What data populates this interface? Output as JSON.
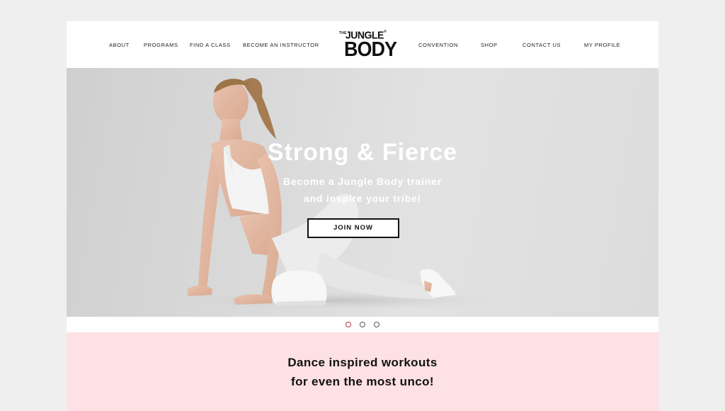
{
  "nav": {
    "left": [
      "ABOUT",
      "PROGRAMS",
      "FIND A CLASS",
      "BECOME AN INSTRUCTOR"
    ],
    "right": [
      "CONVENTION",
      "SHOP",
      "CONTACT US",
      "MY PROFILE"
    ]
  },
  "logo": {
    "the": "THE",
    "jungle": "JUNGLE",
    "registered": "®",
    "body": "BODY"
  },
  "hero": {
    "title": "Strong & Fierce",
    "subtitle_line1": "Become a Jungle Body trainer",
    "subtitle_line2": "and inspire your tribe!",
    "cta": "JOIN NOW"
  },
  "carousel": {
    "slides": 3,
    "active_index": 0
  },
  "tagline": {
    "line1": "Dance inspired workouts",
    "line2": "for even the most unco!"
  },
  "colors": {
    "page_bg": "#efefef",
    "pink_section": "#fde1e5",
    "text": "#111111",
    "active_dot": "#b03a48"
  }
}
